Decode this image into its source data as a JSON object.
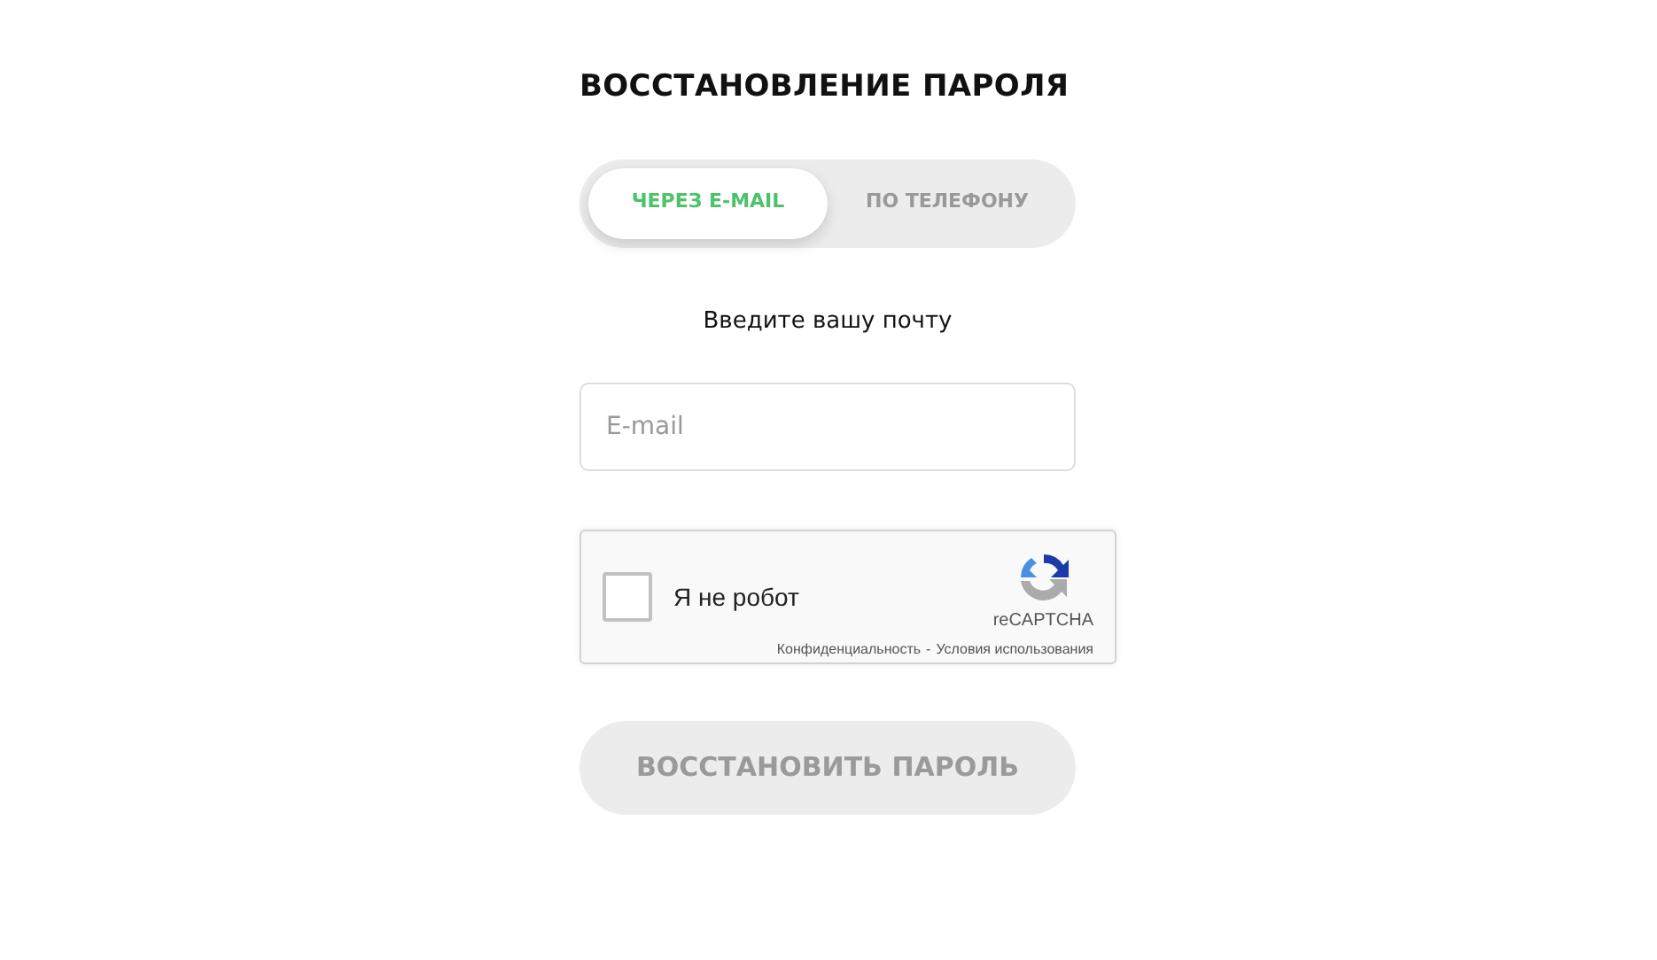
{
  "title": "ВОССТАНОВЛЕНИЕ ПАРОЛЯ",
  "tabs": [
    {
      "label": "ЧЕРЕЗ E-MAIL",
      "selected": true
    },
    {
      "label": "ПО ТЕЛЕФОНУ",
      "selected": false
    }
  ],
  "prompt": "Введите вашу почту",
  "email": {
    "placeholder": "E-mail"
  },
  "captcha": {
    "label": "Я не робот",
    "checked": false,
    "brand": "reCAPTCHA",
    "links": [
      "Конфиденциальность",
      "Условия использования"
    ],
    "separator": "-"
  },
  "submit": {
    "label": "ВОССТАНОВИТЬ ПАРОЛЬ",
    "disabled": true
  }
}
